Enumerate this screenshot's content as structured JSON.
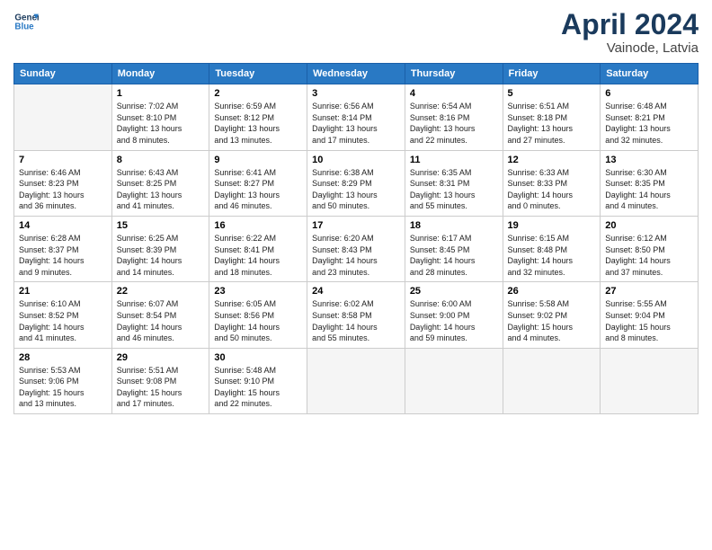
{
  "header": {
    "logo_line1": "General",
    "logo_line2": "Blue",
    "month": "April 2024",
    "location": "Vainode, Latvia"
  },
  "weekdays": [
    "Sunday",
    "Monday",
    "Tuesday",
    "Wednesday",
    "Thursday",
    "Friday",
    "Saturday"
  ],
  "weeks": [
    [
      {
        "day": "",
        "info": ""
      },
      {
        "day": "1",
        "info": "Sunrise: 7:02 AM\nSunset: 8:10 PM\nDaylight: 13 hours\nand 8 minutes."
      },
      {
        "day": "2",
        "info": "Sunrise: 6:59 AM\nSunset: 8:12 PM\nDaylight: 13 hours\nand 13 minutes."
      },
      {
        "day": "3",
        "info": "Sunrise: 6:56 AM\nSunset: 8:14 PM\nDaylight: 13 hours\nand 17 minutes."
      },
      {
        "day": "4",
        "info": "Sunrise: 6:54 AM\nSunset: 8:16 PM\nDaylight: 13 hours\nand 22 minutes."
      },
      {
        "day": "5",
        "info": "Sunrise: 6:51 AM\nSunset: 8:18 PM\nDaylight: 13 hours\nand 27 minutes."
      },
      {
        "day": "6",
        "info": "Sunrise: 6:48 AM\nSunset: 8:21 PM\nDaylight: 13 hours\nand 32 minutes."
      }
    ],
    [
      {
        "day": "7",
        "info": "Sunrise: 6:46 AM\nSunset: 8:23 PM\nDaylight: 13 hours\nand 36 minutes."
      },
      {
        "day": "8",
        "info": "Sunrise: 6:43 AM\nSunset: 8:25 PM\nDaylight: 13 hours\nand 41 minutes."
      },
      {
        "day": "9",
        "info": "Sunrise: 6:41 AM\nSunset: 8:27 PM\nDaylight: 13 hours\nand 46 minutes."
      },
      {
        "day": "10",
        "info": "Sunrise: 6:38 AM\nSunset: 8:29 PM\nDaylight: 13 hours\nand 50 minutes."
      },
      {
        "day": "11",
        "info": "Sunrise: 6:35 AM\nSunset: 8:31 PM\nDaylight: 13 hours\nand 55 minutes."
      },
      {
        "day": "12",
        "info": "Sunrise: 6:33 AM\nSunset: 8:33 PM\nDaylight: 14 hours\nand 0 minutes."
      },
      {
        "day": "13",
        "info": "Sunrise: 6:30 AM\nSunset: 8:35 PM\nDaylight: 14 hours\nand 4 minutes."
      }
    ],
    [
      {
        "day": "14",
        "info": "Sunrise: 6:28 AM\nSunset: 8:37 PM\nDaylight: 14 hours\nand 9 minutes."
      },
      {
        "day": "15",
        "info": "Sunrise: 6:25 AM\nSunset: 8:39 PM\nDaylight: 14 hours\nand 14 minutes."
      },
      {
        "day": "16",
        "info": "Sunrise: 6:22 AM\nSunset: 8:41 PM\nDaylight: 14 hours\nand 18 minutes."
      },
      {
        "day": "17",
        "info": "Sunrise: 6:20 AM\nSunset: 8:43 PM\nDaylight: 14 hours\nand 23 minutes."
      },
      {
        "day": "18",
        "info": "Sunrise: 6:17 AM\nSunset: 8:45 PM\nDaylight: 14 hours\nand 28 minutes."
      },
      {
        "day": "19",
        "info": "Sunrise: 6:15 AM\nSunset: 8:48 PM\nDaylight: 14 hours\nand 32 minutes."
      },
      {
        "day": "20",
        "info": "Sunrise: 6:12 AM\nSunset: 8:50 PM\nDaylight: 14 hours\nand 37 minutes."
      }
    ],
    [
      {
        "day": "21",
        "info": "Sunrise: 6:10 AM\nSunset: 8:52 PM\nDaylight: 14 hours\nand 41 minutes."
      },
      {
        "day": "22",
        "info": "Sunrise: 6:07 AM\nSunset: 8:54 PM\nDaylight: 14 hours\nand 46 minutes."
      },
      {
        "day": "23",
        "info": "Sunrise: 6:05 AM\nSunset: 8:56 PM\nDaylight: 14 hours\nand 50 minutes."
      },
      {
        "day": "24",
        "info": "Sunrise: 6:02 AM\nSunset: 8:58 PM\nDaylight: 14 hours\nand 55 minutes."
      },
      {
        "day": "25",
        "info": "Sunrise: 6:00 AM\nSunset: 9:00 PM\nDaylight: 14 hours\nand 59 minutes."
      },
      {
        "day": "26",
        "info": "Sunrise: 5:58 AM\nSunset: 9:02 PM\nDaylight: 15 hours\nand 4 minutes."
      },
      {
        "day": "27",
        "info": "Sunrise: 5:55 AM\nSunset: 9:04 PM\nDaylight: 15 hours\nand 8 minutes."
      }
    ],
    [
      {
        "day": "28",
        "info": "Sunrise: 5:53 AM\nSunset: 9:06 PM\nDaylight: 15 hours\nand 13 minutes."
      },
      {
        "day": "29",
        "info": "Sunrise: 5:51 AM\nSunset: 9:08 PM\nDaylight: 15 hours\nand 17 minutes."
      },
      {
        "day": "30",
        "info": "Sunrise: 5:48 AM\nSunset: 9:10 PM\nDaylight: 15 hours\nand 22 minutes."
      },
      {
        "day": "",
        "info": ""
      },
      {
        "day": "",
        "info": ""
      },
      {
        "day": "",
        "info": ""
      },
      {
        "day": "",
        "info": ""
      }
    ]
  ]
}
